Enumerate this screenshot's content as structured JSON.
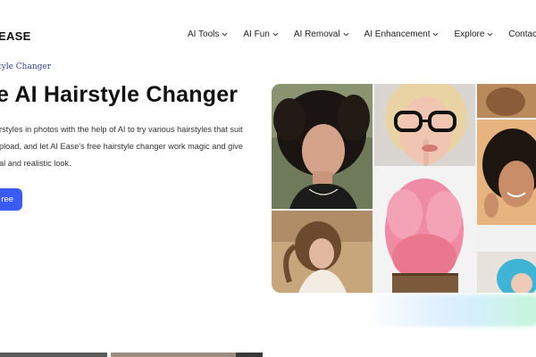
{
  "header": {
    "logo_text": "EASE",
    "menu": [
      {
        "label": "AI Tools",
        "icon": "chevron-down-icon"
      },
      {
        "label": "AI Fun",
        "icon": "chevron-down-icon"
      },
      {
        "label": "AI Removal",
        "icon": "chevron-down-icon"
      },
      {
        "label": "AI Enhancement",
        "icon": "chevron-down-icon"
      },
      {
        "label": "Explore",
        "icon": "chevron-down-icon"
      },
      {
        "label": "Contact U",
        "icon": ""
      }
    ]
  },
  "hero": {
    "breadcrumb": "tyle Changer",
    "title": "e AI Hairstyle Changer",
    "description_lines": [
      "rstyles in photos with the help of AI to try various hairstyles that suit",
      "pload, and let AI Ease's free hairstyle changer work magic and give",
      "al and realistic look."
    ],
    "cta_label": "ree"
  },
  "colors": {
    "accent": "#3b5bf6",
    "breadcrumb": "#2a3f8f",
    "title": "#111111"
  }
}
